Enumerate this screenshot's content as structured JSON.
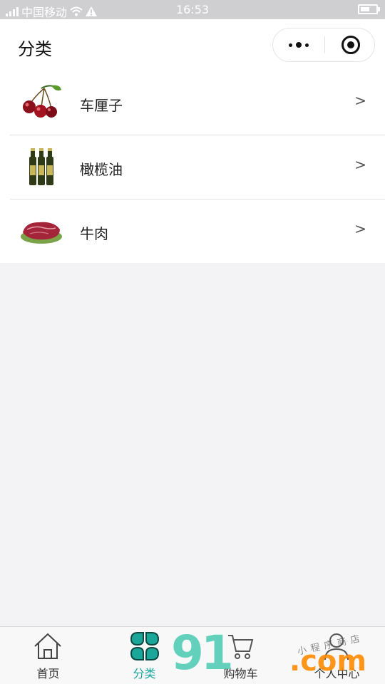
{
  "status_bar": {
    "carrier": "中国移动",
    "time": "16:53",
    "icons": [
      "signal-icon",
      "wifi-icon",
      "warning-icon",
      "battery-icon"
    ]
  },
  "nav": {
    "title": "分类",
    "capsule_icons": [
      "more-dots-icon",
      "target-icon"
    ]
  },
  "categories": [
    {
      "label": "车厘子",
      "icon": "cherries-thumbnail",
      "arrow": ">"
    },
    {
      "label": "橄榄油",
      "icon": "olive-oil-bottles-thumbnail",
      "arrow": ">"
    },
    {
      "label": "牛肉",
      "icon": "beef-thumbnail",
      "arrow": ">"
    }
  ],
  "tabbar": {
    "tabs": [
      {
        "label": "首页",
        "icon": "home-icon",
        "active": false
      },
      {
        "label": "分类",
        "icon": "category-icon",
        "active": true
      },
      {
        "label": "购物车",
        "icon": "cart-icon",
        "active": false
      },
      {
        "label": "个人中心",
        "icon": "user-icon",
        "active": false
      }
    ],
    "active_color": "#1aa79a"
  },
  "watermark": {
    "brand": "91",
    "suffix": ".com",
    "handwriting": "小程序商店"
  },
  "colors": {
    "accent": "#1aa79a",
    "page_bg": "#f3f2f4",
    "status_bar_bg": "#cfcfd1"
  }
}
